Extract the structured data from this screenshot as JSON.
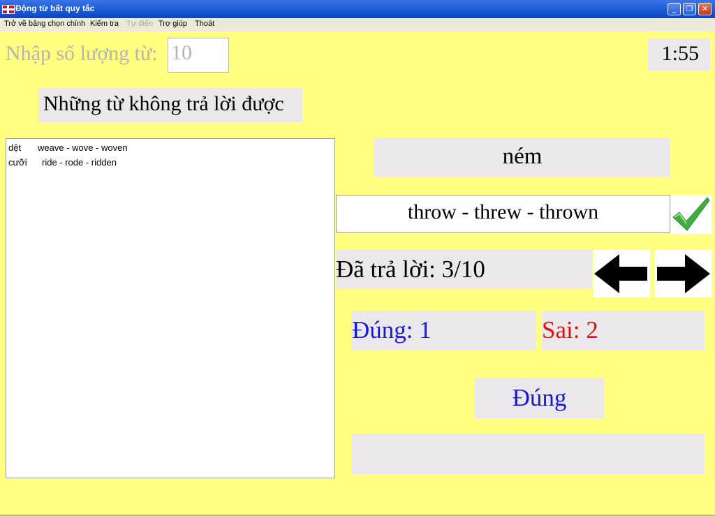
{
  "window": {
    "title": "Động từ bất quy tắc",
    "minimize_glyph": "_",
    "restore_glyph": "❐",
    "close_glyph": "✕"
  },
  "menu": [
    {
      "label": "Trở về bảng chọn chính",
      "disabled": false
    },
    {
      "label": "Kiểm tra",
      "disabled": false
    },
    {
      "label": "Tự điển",
      "disabled": true
    },
    {
      "label": "Trợ giúp",
      "disabled": false
    },
    {
      "label": "Thoát",
      "disabled": false
    }
  ],
  "quantity": {
    "label": "Nhập số lượng từ:",
    "value": "10"
  },
  "timer": "1:55",
  "unanswered": {
    "title": "Những từ không trả lời được",
    "items": [
      {
        "vn": "dệt",
        "en": "weave - wove - woven"
      },
      {
        "vn": "cưỡi",
        "en": "ride - rode - ridden"
      }
    ]
  },
  "question": {
    "prompt": "ném",
    "answer": "throw - threw - thrown"
  },
  "progress": "Đã trả lời: 3/10",
  "score": {
    "correct": "Đúng: 1",
    "wrong": "Sai: 2"
  },
  "result": "Đúng",
  "icons": {
    "check": "check-icon",
    "prev": "arrow-left-icon",
    "next": "arrow-right-icon"
  },
  "colors": {
    "background": "#ffff80",
    "panel": "#ebe8ec",
    "correct": "#1a1ad0",
    "wrong": "#e41010",
    "check": "#3fae3f"
  }
}
